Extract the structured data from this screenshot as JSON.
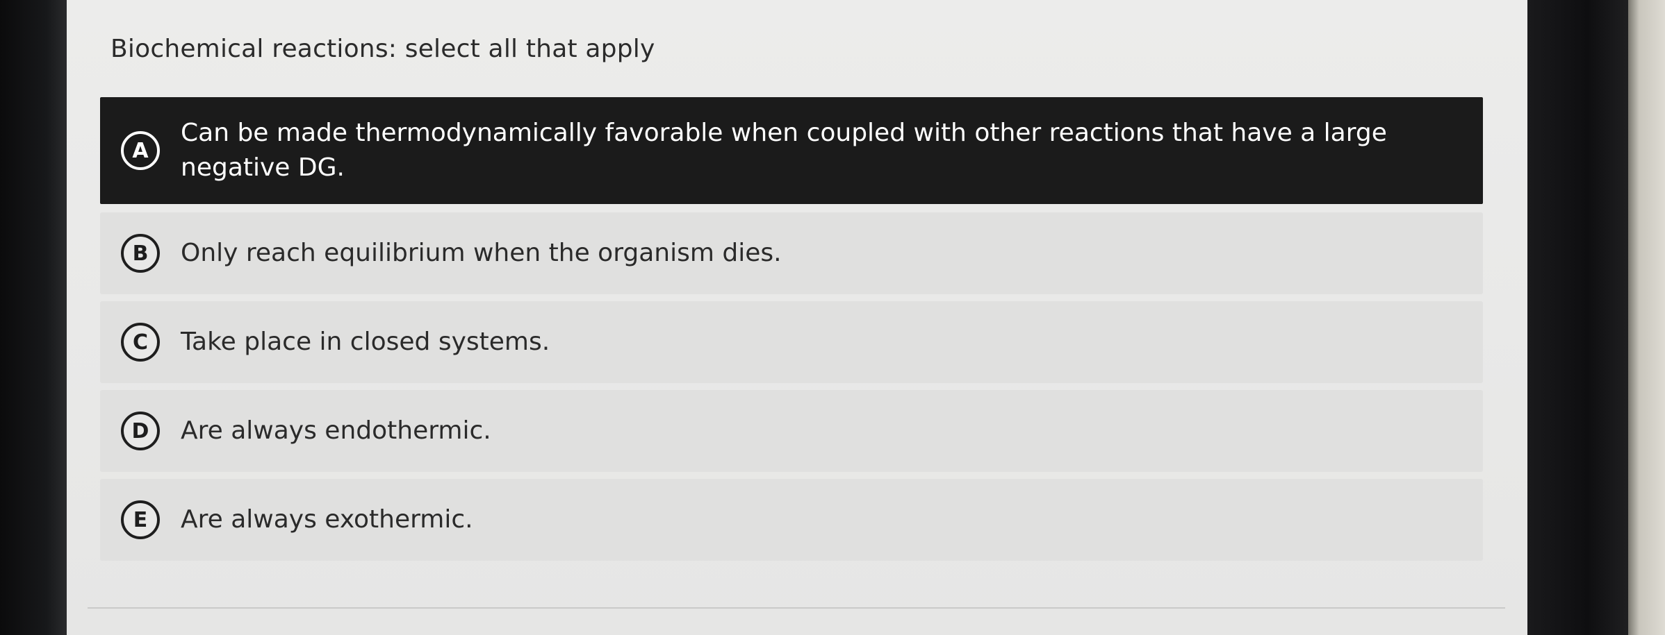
{
  "question": {
    "title": "Biochemical reactions: select all that apply"
  },
  "options": [
    {
      "letter": "A",
      "text": "Can be made thermodynamically favorable when coupled with other reactions that have a large negative DG.",
      "selected": true
    },
    {
      "letter": "B",
      "text": "Only reach equilibrium when the organism dies.",
      "selected": false
    },
    {
      "letter": "C",
      "text": "Take place in closed systems.",
      "selected": false
    },
    {
      "letter": "D",
      "text": "Are always endothermic.",
      "selected": false
    },
    {
      "letter": "E",
      "text": "Are always exothermic.",
      "selected": false
    }
  ],
  "colors": {
    "selected_background": "#1b1b1b",
    "option_background": "#e0e0df",
    "screen_background": "#ececeb"
  }
}
